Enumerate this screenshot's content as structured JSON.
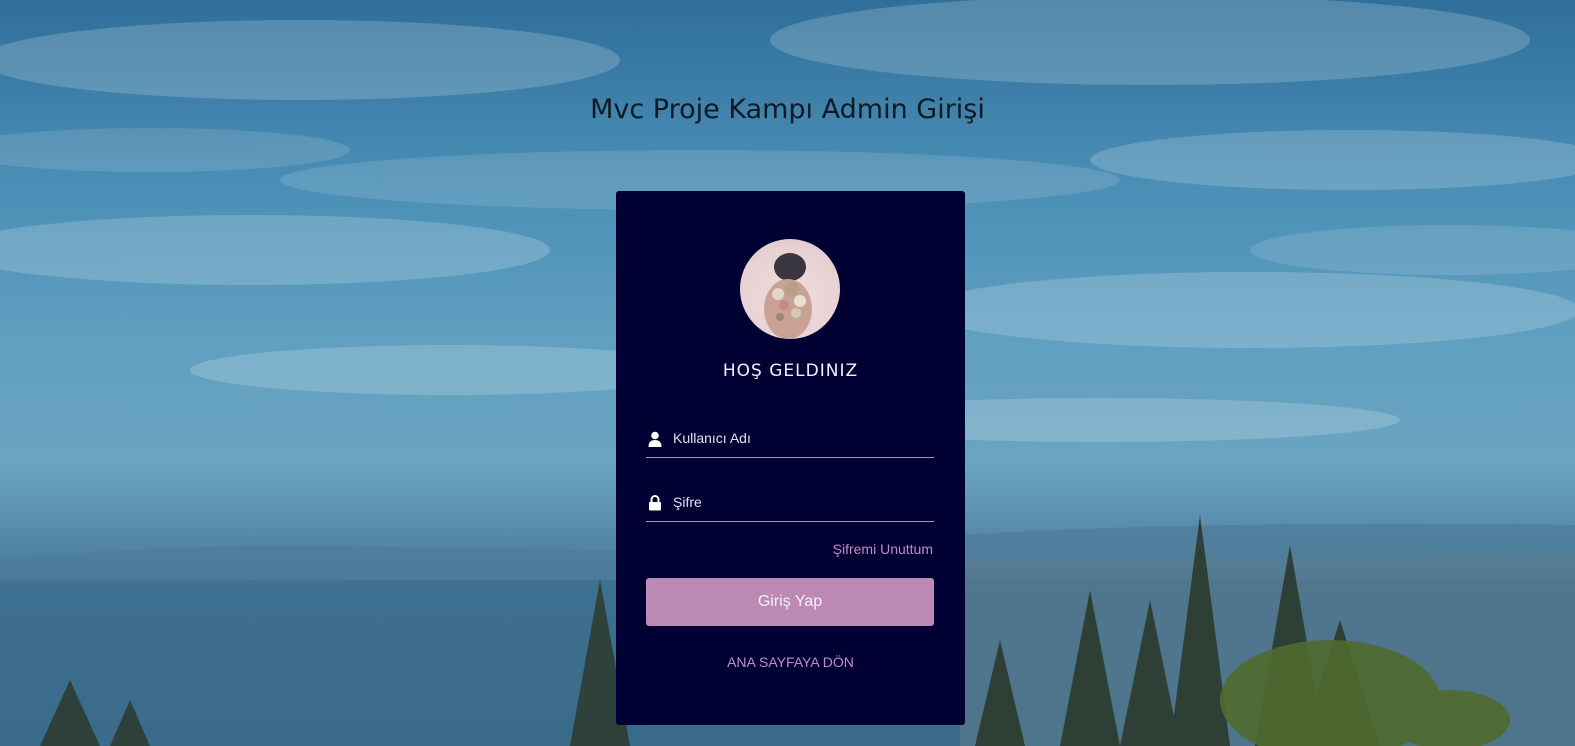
{
  "page": {
    "title": "Mvc Proje Kampı Admin Girişi"
  },
  "login_card": {
    "avatar_icon": "profile-photo",
    "welcome": "HOŞ GELDINIZ",
    "username": {
      "placeholder": "Kullanıcı Adı",
      "value": "",
      "icon": "user-icon"
    },
    "password": {
      "placeholder": "Şifre",
      "value": "",
      "icon": "lock-icon"
    },
    "forgot_label": "Şifremi Unuttum",
    "submit_label": "Giriş Yap",
    "home_label": "ANA SAYFAYA DÖN"
  },
  "colors": {
    "card_background": "#010033",
    "accent": "#bb89b3",
    "link": "#c28cc1",
    "title_text": "#111a22"
  }
}
